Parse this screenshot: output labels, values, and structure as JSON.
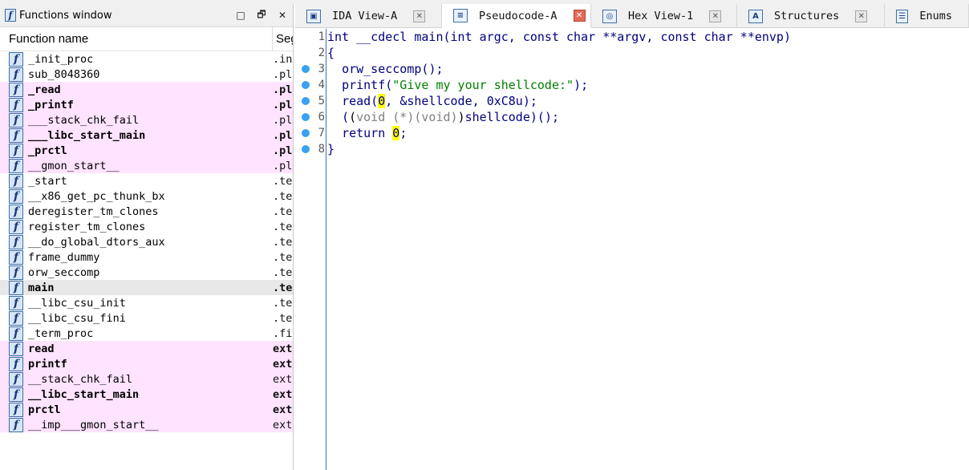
{
  "functions_window": {
    "title": "Functions window",
    "controls": {
      "restore": "□",
      "maximize": "🗗",
      "close": "✕"
    },
    "columns": {
      "name": "Function name",
      "segment": "Segment"
    },
    "rows": [
      {
        "name": "_init_proc",
        "segment": ".init",
        "pink": false,
        "bold": false
      },
      {
        "name": "sub_8048360",
        "segment": ".plt",
        "pink": false,
        "bold": false
      },
      {
        "name": "_read",
        "segment": ".plt",
        "pink": true,
        "bold": true
      },
      {
        "name": "_printf",
        "segment": ".plt",
        "pink": true,
        "bold": true
      },
      {
        "name": "___stack_chk_fail",
        "segment": ".plt",
        "pink": true,
        "bold": false
      },
      {
        "name": "___libc_start_main",
        "segment": ".plt",
        "pink": true,
        "bold": true
      },
      {
        "name": "_prctl",
        "segment": ".plt",
        "pink": true,
        "bold": true
      },
      {
        "name": "__gmon_start__",
        "segment": ".plt",
        "pink": true,
        "bold": false
      },
      {
        "name": "_start",
        "segment": ".text",
        "pink": false,
        "bold": false
      },
      {
        "name": "__x86_get_pc_thunk_bx",
        "segment": ".text",
        "pink": false,
        "bold": false
      },
      {
        "name": "deregister_tm_clones",
        "segment": ".text",
        "pink": false,
        "bold": false
      },
      {
        "name": "register_tm_clones",
        "segment": ".text",
        "pink": false,
        "bold": false
      },
      {
        "name": "__do_global_dtors_aux",
        "segment": ".text",
        "pink": false,
        "bold": false
      },
      {
        "name": "frame_dummy",
        "segment": ".text",
        "pink": false,
        "bold": false
      },
      {
        "name": "orw_seccomp",
        "segment": ".text",
        "pink": false,
        "bold": false
      },
      {
        "name": "main",
        "segment": ".text",
        "pink": false,
        "bold": true,
        "selected": true
      },
      {
        "name": "__libc_csu_init",
        "segment": ".text",
        "pink": false,
        "bold": false
      },
      {
        "name": "__libc_csu_fini",
        "segment": ".text",
        "pink": false,
        "bold": false
      },
      {
        "name": "_term_proc",
        "segment": ".fini",
        "pink": false,
        "bold": false
      },
      {
        "name": "read",
        "segment": "extern",
        "pink": true,
        "bold": true
      },
      {
        "name": "printf",
        "segment": "extern",
        "pink": true,
        "bold": true
      },
      {
        "name": "__stack_chk_fail",
        "segment": "extern",
        "pink": true,
        "bold": false
      },
      {
        "name": "__libc_start_main",
        "segment": "extern",
        "pink": true,
        "bold": true
      },
      {
        "name": "prctl",
        "segment": "extern",
        "pink": true,
        "bold": true
      },
      {
        "name": "__imp___gmon_start__",
        "segment": "extern",
        "pink": true,
        "bold": false
      }
    ]
  },
  "tabs": [
    {
      "label": "IDA View-A",
      "icon": "ida-view-icon",
      "active": false
    },
    {
      "label": "Pseudocode-A",
      "icon": "pseudocode-icon",
      "active": true
    },
    {
      "label": "Hex View-1",
      "icon": "hex-view-icon",
      "active": false
    },
    {
      "label": "Structures",
      "icon": "structures-icon",
      "active": false
    },
    {
      "label": "Enums",
      "icon": "enums-icon",
      "active": false
    }
  ],
  "pseudocode": {
    "lines": [
      {
        "num": "1",
        "breakpoint": false,
        "code": "int __cdecl main(int argc, const char **argv, const char **envp)"
      },
      {
        "num": "2",
        "breakpoint": false,
        "code": "{"
      },
      {
        "num": "3",
        "breakpoint": true,
        "code": "  orw_seccomp();"
      },
      {
        "num": "4",
        "breakpoint": true,
        "code": "  printf(\"Give my your shellcode:\");"
      },
      {
        "num": "5",
        "breakpoint": true,
        "code": "  read(0, &shellcode, 0xC8u);"
      },
      {
        "num": "6",
        "breakpoint": true,
        "code": "  ((void (*)(void))shellcode)();"
      },
      {
        "num": "7",
        "breakpoint": true,
        "code": "  return 0;"
      },
      {
        "num": "8",
        "breakpoint": true,
        "code": "}"
      }
    ]
  },
  "colors": {
    "pink_row": "#ffe3ff",
    "breakpoint": "#3aa1ee",
    "keyword": "#000080",
    "string": "#008000",
    "highlight": "#ffff00"
  }
}
